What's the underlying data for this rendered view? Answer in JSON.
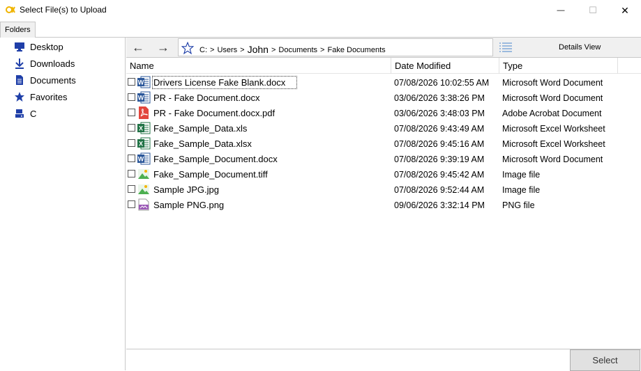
{
  "window": {
    "title": "Select File(s) to Upload",
    "minimize_glyph": "—",
    "maximize_glyph": "☐",
    "close_glyph": "✕"
  },
  "tabs": {
    "folders": "Folders"
  },
  "sidebar": {
    "items": [
      {
        "label": "Desktop",
        "icon": "desktop-icon"
      },
      {
        "label": "Downloads",
        "icon": "download-icon"
      },
      {
        "label": "Documents",
        "icon": "document-icon"
      },
      {
        "label": "Favorites",
        "icon": "star-icon"
      },
      {
        "label": "C",
        "icon": "drive-icon"
      }
    ]
  },
  "navbar": {
    "back_glyph": "←",
    "forward_glyph": "→",
    "breadcrumb": [
      "C:",
      "Users",
      "John",
      "Documents",
      "Fake Documents"
    ],
    "breadcrumb_separator": ">",
    "view_label": "Details View"
  },
  "table": {
    "columns": {
      "name": "Name",
      "date": "Date Modified",
      "type": "Type"
    },
    "rows": [
      {
        "name": "Drivers License Fake Blank.docx",
        "date": "07/08/2026 10:02:55 AM",
        "type": "Microsoft Word Document",
        "icon": "word-icon"
      },
      {
        "name": "PR - Fake Document.docx",
        "date": "03/06/2026 3:38:26 PM",
        "type": "Microsoft Word Document",
        "icon": "word-icon"
      },
      {
        "name": "PR - Fake Document.docx.pdf",
        "date": "03/06/2026 3:48:03 PM",
        "type": "Adobe Acrobat Document",
        "icon": "pdf-icon"
      },
      {
        "name": "Fake_Sample_Data.xls",
        "date": "07/08/2026 9:43:49 AM",
        "type": "Microsoft Excel Worksheet",
        "icon": "excel-icon"
      },
      {
        "name": "Fake_Sample_Data.xlsx",
        "date": "07/08/2026 9:45:16 AM",
        "type": "Microsoft Excel Worksheet",
        "icon": "excel-icon"
      },
      {
        "name": "Fake_Sample_Document.docx",
        "date": "07/08/2026 9:39:19 AM",
        "type": "Microsoft Word Document",
        "icon": "word-icon"
      },
      {
        "name": "Fake_Sample_Document.tiff",
        "date": "07/08/2026 9:45:42 AM",
        "type": "Image file",
        "icon": "image-icon"
      },
      {
        "name": "Sample JPG.jpg",
        "date": "07/08/2026 9:52:44 AM",
        "type": "Image file",
        "icon": "image-icon"
      },
      {
        "name": "Sample PNG.png",
        "date": "09/06/2026 3:32:14 PM",
        "type": "PNG file",
        "icon": "png-icon"
      }
    ]
  },
  "footer": {
    "select_label": "Select"
  },
  "colors": {
    "word": "#2b579a",
    "excel": "#217346",
    "pdf": "#e2453c",
    "image_green": "#4caf50",
    "png_purple": "#9b59b6",
    "nav_blue": "#1f3fa8"
  }
}
